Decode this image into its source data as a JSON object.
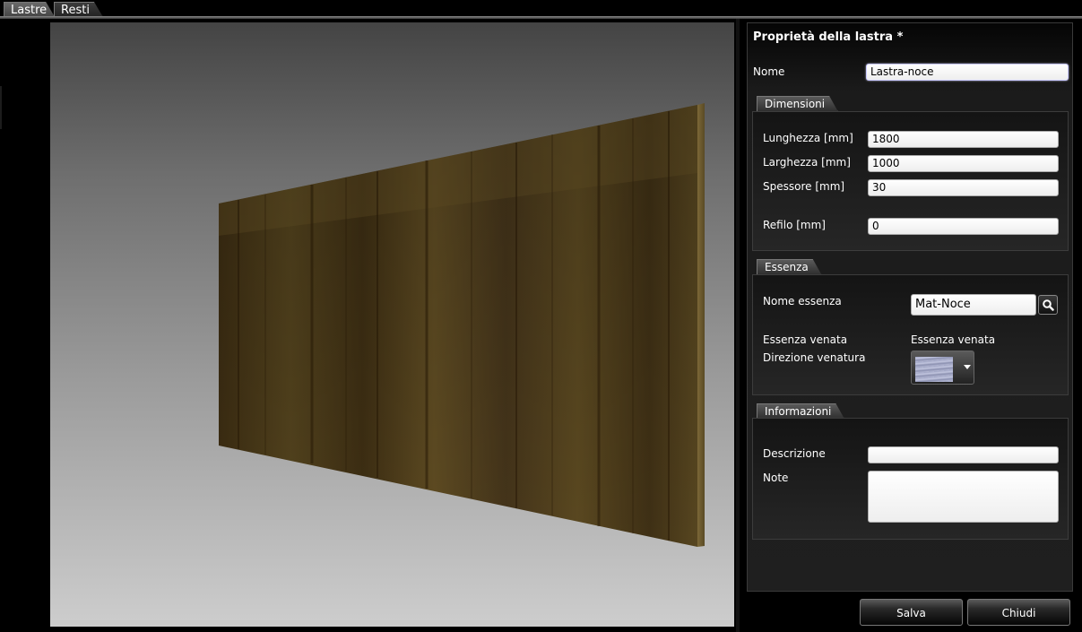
{
  "tabs": [
    {
      "label": "Lastre",
      "active": true
    },
    {
      "label": "Resti",
      "active": false
    }
  ],
  "panel": {
    "title": "Proprietà della lastra *",
    "nome_label": "Nome",
    "nome_value": "Lastra-noce"
  },
  "dimensioni": {
    "header": "Dimensioni",
    "lunghezza_label": "Lunghezza [mm]",
    "lunghezza_value": "1800",
    "larghezza_label": "Larghezza [mm]",
    "larghezza_value": "1000",
    "spessore_label": "Spessore [mm]",
    "spessore_value": "30",
    "refilo_label": "Refilo [mm]",
    "refilo_value": "0"
  },
  "essenza": {
    "header": "Essenza",
    "nome_label": "Nome essenza",
    "nome_value": "Mat-Noce",
    "search_icon": "search-icon",
    "venata_label": "Essenza venata",
    "venata_value": "Essenza venata",
    "direzione_label": "Direzione venatura"
  },
  "informazioni": {
    "header": "Informazioni",
    "descrizione_label": "Descrizione",
    "descrizione_value": "",
    "note_label": "Note",
    "note_value": ""
  },
  "buttons": {
    "save": "Salva",
    "close": "Chiudi"
  },
  "colors": {
    "wood_dark": "#3a2a10",
    "wood_mid": "#5c4a22",
    "wood_light": "#75602f",
    "background": "#000000"
  }
}
